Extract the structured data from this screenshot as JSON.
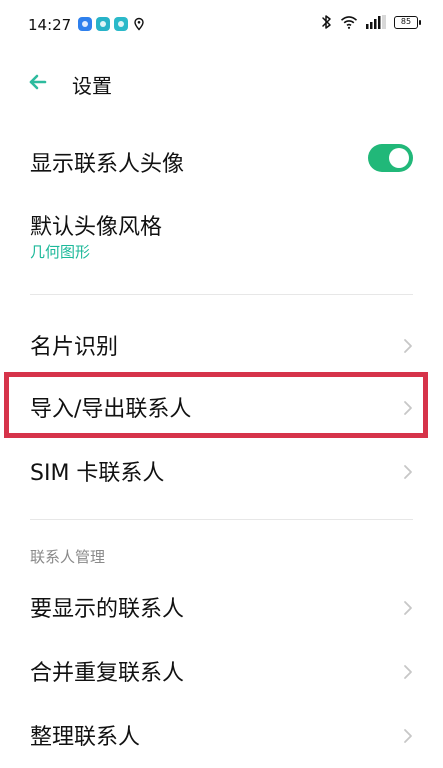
{
  "status_bar": {
    "time": "14:27",
    "battery": "85",
    "icons": [
      "app-notification-icon",
      "gallery-icon",
      "messages-icon",
      "location-icon",
      "bluetooth-icon",
      "wifi-icon",
      "signal-icon",
      "battery-icon"
    ]
  },
  "header": {
    "title": "设置",
    "back_icon": "arrow-left-icon"
  },
  "settings": {
    "show_avatar": {
      "label": "显示联系人头像",
      "enabled": true
    },
    "avatar_style": {
      "label": "默认头像风格",
      "value": "几何图形"
    },
    "items": [
      {
        "label": "名片识别"
      },
      {
        "label": "导入/导出联系人"
      },
      {
        "label": "SIM 卡联系人"
      }
    ],
    "section_title": "联系人管理",
    "management_items": [
      {
        "label": "要显示的联系人"
      },
      {
        "label": "合并重复联系人"
      },
      {
        "label": "整理联系人"
      }
    ]
  },
  "colors": {
    "accent": "#21b879",
    "accent_text": "#1db99a",
    "highlight": "#d6334a",
    "section_text": "#8a8a8a"
  }
}
